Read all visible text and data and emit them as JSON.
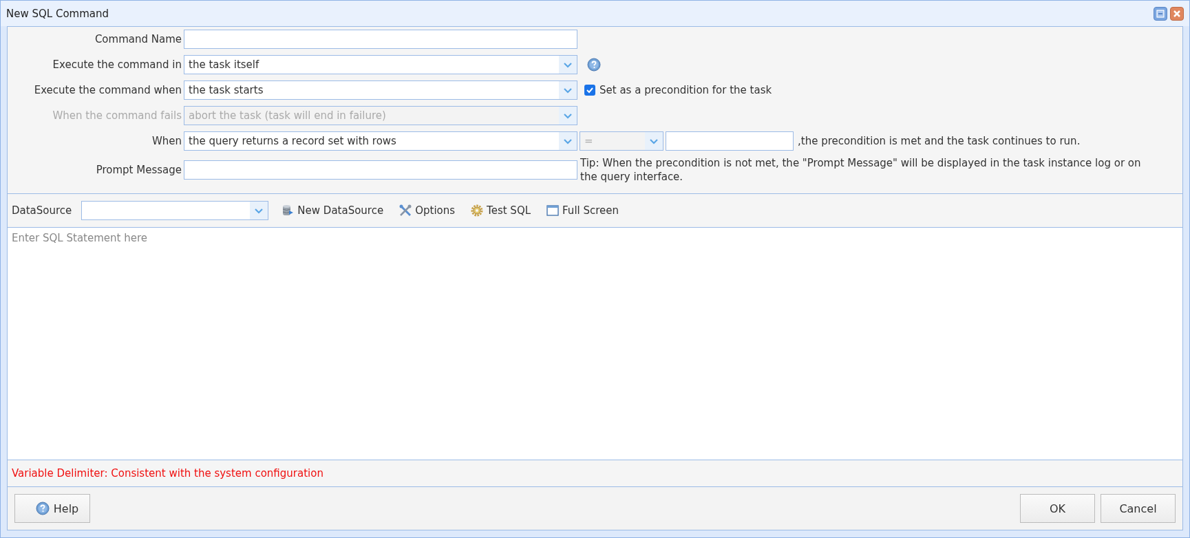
{
  "window": {
    "title": "New SQL Command"
  },
  "form": {
    "rows": [
      {
        "kind": "text",
        "label": "Command Name",
        "disabled": false
      },
      {
        "kind": "select",
        "label": "Execute the command in",
        "value": "the task itself",
        "disabled": false,
        "help_icon": true
      },
      {
        "kind": "select",
        "label": "Execute the command when",
        "value": "the task starts",
        "disabled": false,
        "checkbox": {
          "label": "Set as a precondition for the task",
          "checked": true
        }
      },
      {
        "kind": "select",
        "label": "When the command fails",
        "value": "abort the task (task will end in failure)",
        "disabled": true
      },
      {
        "kind": "select",
        "label": "When",
        "value": "the query returns a record set with rows",
        "disabled": false,
        "operator": {
          "value": "=",
          "disabled": true
        },
        "value_field": {
          "disabled": false
        },
        "suffix": ",the precondition is met and the task continues to run."
      },
      {
        "kind": "text",
        "label": "Prompt Message",
        "disabled": false,
        "tip": "Tip: When the precondition is not met, the \"Prompt Message\" will be displayed in the task instance log or on the query interface."
      }
    ]
  },
  "toolbar": {
    "label": "DataSource",
    "buttons": [
      {
        "kind": "datasource",
        "label": "New DataSource"
      },
      {
        "kind": "options",
        "label": "Options"
      },
      {
        "kind": "test",
        "label": "Test SQL"
      },
      {
        "kind": "fullscreen",
        "label": "Full Screen"
      }
    ]
  },
  "editor": {
    "placeholder": "Enter SQL Statement here"
  },
  "status": "Variable Delimiter: Consistent with the system configuration",
  "footer": {
    "help": "Help",
    "buttons": [
      "OK",
      "Cancel"
    ]
  }
}
